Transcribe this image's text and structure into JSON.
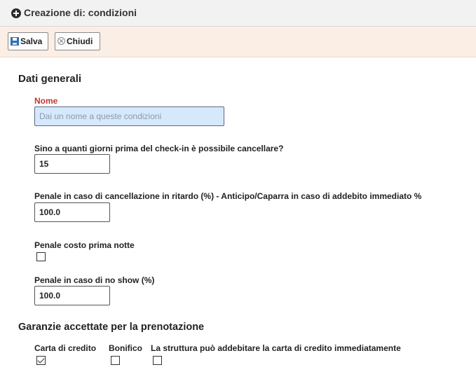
{
  "header": {
    "title": "Creazione di: condizioni",
    "icon": "plus-circle-icon"
  },
  "toolbar": {
    "save_label": "Salva",
    "close_label": "Chiudi"
  },
  "section_general": {
    "title": "Dati generali"
  },
  "fields": {
    "name": {
      "label": "Nome",
      "placeholder": "Dai un nome a queste condizioni",
      "value": ""
    },
    "cancel_days": {
      "label": "Sino a quanti giorni prima del check-in è possibile cancellare?",
      "value": "15"
    },
    "late_penalty": {
      "label": "Penale in caso di cancellazione in ritardo (%) - Anticipo/Caparra in caso di addebito immediato %",
      "value": "100.0"
    },
    "first_night": {
      "label": "Penale costo prima notte",
      "checked": false
    },
    "no_show": {
      "label": "Penale in caso di no show (%)",
      "value": "100.0"
    }
  },
  "section_guarantees": {
    "title": "Garanzie accettate per la prenotazione",
    "options": [
      {
        "label": "Carta di credito",
        "checked": true
      },
      {
        "label": "Bonifico",
        "checked": false
      },
      {
        "label": "La struttura può addebitare la carta di credito immediatamente",
        "checked": false
      }
    ]
  },
  "colors": {
    "toolbar_bg": "#fbeee4",
    "required_label": "#c0392b",
    "name_input_bg": "#d6e8fb"
  }
}
